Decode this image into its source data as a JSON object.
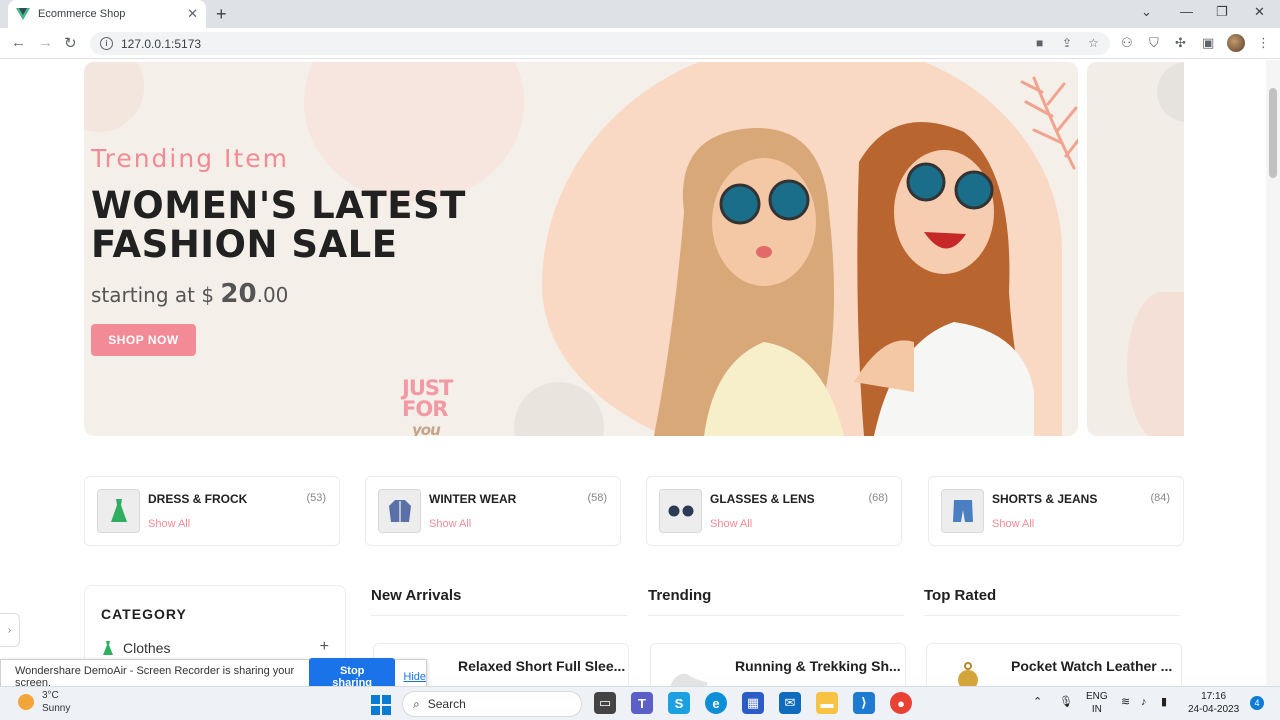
{
  "browser": {
    "tab_title": "Ecommerce Shop",
    "tab_close": "✕",
    "new_tab": "+",
    "url": "127.0.0.1:5173"
  },
  "banner": {
    "subtitle": "Trending Item",
    "headline_line1": "WOMEN'S LATEST",
    "headline_line2": "FASHION SALE",
    "price_prefix": "starting at $ ",
    "price_amount": "20",
    "price_cents": ".00",
    "button": "SHOP NOW",
    "badge_top": "JUST",
    "badge_mid": "FOR",
    "badge_script": "you"
  },
  "categories": [
    {
      "name": "DRESS & FROCK",
      "count": "(53)",
      "link": "Show All",
      "icon": "dress-icon"
    },
    {
      "name": "WINTER WEAR",
      "count": "(58)",
      "link": "Show All",
      "icon": "jacket-icon"
    },
    {
      "name": "GLASSES & LENS",
      "count": "(68)",
      "link": "Show All",
      "icon": "glasses-icon"
    },
    {
      "name": "SHORTS & JEANS",
      "count": "(84)",
      "link": "Show All",
      "icon": "shorts-icon"
    }
  ],
  "sidebar": {
    "title": "CATEGORY",
    "items": [
      {
        "label": "Clothes",
        "expand": "+"
      }
    ]
  },
  "columns": [
    {
      "title": "New Arrivals",
      "first_product": "Relaxed Short Full Slee..."
    },
    {
      "title": "Trending",
      "first_product": "Running & Trekking Sh..."
    },
    {
      "title": "Top Rated",
      "first_product": "Pocket Watch Leather ..."
    }
  ],
  "share_bar": {
    "message": "Wondershare DemoAir - Screen Recorder is sharing your screen.",
    "stop": "Stop sharing",
    "hide": "Hide"
  },
  "taskbar": {
    "weather_temp": "3°C",
    "weather_cond": "Sunny",
    "search": "Search",
    "lang1": "ENG",
    "lang2": "IN",
    "time": "17:16",
    "date": "24-04-2023",
    "notifications": "4"
  },
  "colors": {
    "accent": "#f28b95",
    "banner_bg": "#f4efe9",
    "chrome_tab": "#dee1e6"
  }
}
